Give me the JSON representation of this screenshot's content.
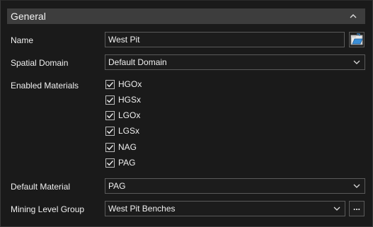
{
  "panel": {
    "title": "General"
  },
  "name": {
    "label": "Name",
    "value": "West Pit"
  },
  "spatial_domain": {
    "label": "Spatial Domain",
    "value": "Default Domain"
  },
  "enabled_materials": {
    "label": "Enabled Materials",
    "items": [
      {
        "label": "HGOx",
        "checked": true
      },
      {
        "label": "HGSx",
        "checked": true
      },
      {
        "label": "LGOx",
        "checked": true
      },
      {
        "label": "LGSx",
        "checked": true
      },
      {
        "label": "NAG",
        "checked": true
      },
      {
        "label": "PAG",
        "checked": true
      }
    ]
  },
  "default_material": {
    "label": "Default Material",
    "value": "PAG"
  },
  "mining_level_group": {
    "label": "Mining Level Group",
    "value": "West Pit Benches",
    "browse_label": "..."
  },
  "icons": {
    "collapse": "chevron-up-icon",
    "name_action": "open-folder-icon",
    "dropdown": "chevron-down-icon",
    "check": "check-icon"
  },
  "colors": {
    "background": "#1a1a1a",
    "header": "#3d3d3d",
    "field_border": "#5a5a5a",
    "folder_accent": "#3a8fd8"
  }
}
